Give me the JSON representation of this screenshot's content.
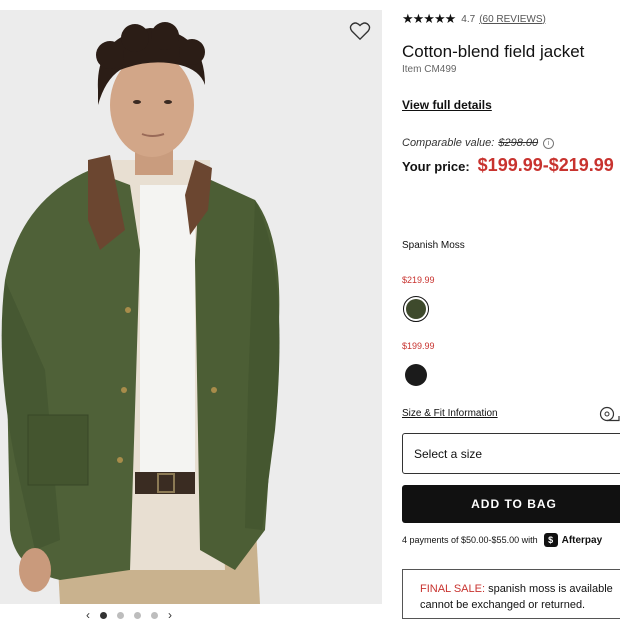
{
  "product": {
    "stars": "★★★★★",
    "rating": "4.7",
    "reviews": "(60 REVIEWS)",
    "title": "Cotton-blend field jacket",
    "item": "Item CM499",
    "view_details": "View full details",
    "comparable_label": "Comparable value:",
    "comparable_price": "$298.00",
    "your_price_label": "Your price:",
    "your_price": "$199.99-$219.99"
  },
  "color": {
    "name": "Spanish Moss",
    "swatches": [
      {
        "price": "$219.99",
        "color": "#3e4a2c",
        "selected": true
      },
      {
        "price": "$199.99",
        "color": "#1b1b1b",
        "selected": false
      }
    ]
  },
  "size": {
    "fit_link": "Size & Fit Information",
    "placeholder": "Select a size"
  },
  "cart": {
    "add_label": "ADD TO BAG",
    "installments": "4 payments of $50.00-$55.00 with",
    "provider": "Afterpay"
  },
  "notice": {
    "label": "FINAL SALE:",
    "text": " spanish moss is available",
    "text2": "cannot be exchanged or returned."
  },
  "gallery": {
    "prev": "‹",
    "next": "›",
    "active_index": 0,
    "count": 4
  }
}
